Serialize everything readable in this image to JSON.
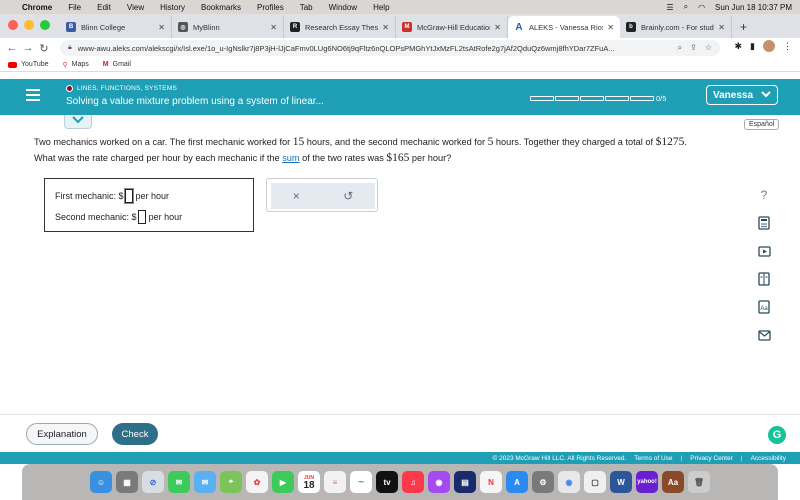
{
  "menubar": {
    "app": "Chrome",
    "items": [
      "File",
      "Edit",
      "View",
      "History",
      "Bookmarks",
      "Profiles",
      "Tab",
      "Window",
      "Help"
    ],
    "datetime": "Sun Jun 18  10:37 PM"
  },
  "tabs": [
    {
      "title": "Blinn College",
      "color": "#3b5ba5"
    },
    {
      "title": "MyBlinn",
      "color": "#555555"
    },
    {
      "title": "Research Essay Thesis",
      "color": "#222222"
    },
    {
      "title": "McGraw-Hill Education C",
      "color": "#c8312c"
    },
    {
      "title": "ALEKS - Vanessa Rios -",
      "color": "#1f5fa8"
    },
    {
      "title": "Brainly.com - For studen",
      "color": "#222222"
    }
  ],
  "address": {
    "url": "www-awu.aleks.com/alekscgi/x/Isl.exe/1o_u-IgNslkr7j8P3jH-lJjCaFmv0LUg6NO6tj9qFltz6nQLOPsPMGhYtJxMzFL2tsAtRofe2g7jAf2QduQz6wmj8fhYDar7ZFuA..."
  },
  "bookmarks": [
    "YouTube",
    "Maps",
    "Gmail"
  ],
  "header": {
    "section": "LINES, FUNCTIONS, SYSTEMS",
    "title": "Solving a value mixture problem using a system of linear...",
    "progress": "0/5",
    "progress_value": 0,
    "progress_total": 5,
    "user": "Vanessa"
  },
  "language_button": "Español",
  "problem": {
    "p1": "Two mechanics worked on a car. The first mechanic worked for ",
    "h1": "15",
    "p2": " hours, and the second mechanic worked for ",
    "h2": "5",
    "p3": " hours. Together they charged a total of ",
    "total": "$1275",
    "p4": ".",
    "p5": "What was the rate charged per hour by each mechanic if the ",
    "link": "sum",
    "p6": " of the two rates was ",
    "sumrate": "$165",
    "p7": " per hour?"
  },
  "answers": {
    "first_label": "First mechanic: $",
    "first_value": "",
    "second_label": "Second mechanic: $",
    "second_value": "",
    "unit": "per hour"
  },
  "tools": {
    "clear": "×",
    "undo": "↺"
  },
  "footer": {
    "explanation": "Explanation",
    "check": "Check",
    "copyright": "© 2023 McGraw Hill LLC. All Rights Reserved.",
    "terms": "Terms of Use",
    "privacy": "Privacy Center",
    "accessibility": "Accessibility"
  },
  "dock": {
    "calendar_day": "18",
    "calendar_month": "JUN",
    "badge": "1"
  }
}
